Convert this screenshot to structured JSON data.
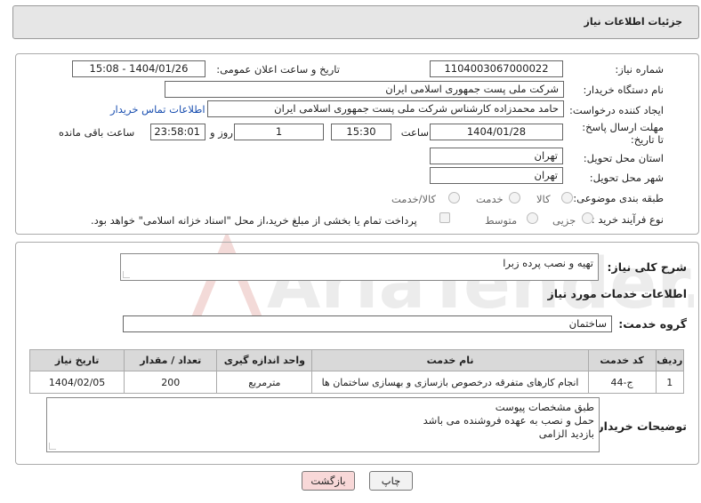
{
  "header": {
    "title": "جزئیات اطلاعات نیاز"
  },
  "form": {
    "need_number_label": "شماره نیاز:",
    "need_number": "1104003067000022",
    "announce_label": "تاریخ و ساعت اعلان عمومی:",
    "announce_value": "1404/01/26 - 15:08",
    "buyer_org_label": "نام دستگاه خریدار:",
    "buyer_org": "شرکت ملی پست جمهوری اسلامی ایران",
    "creator_label": "ایجاد کننده درخواست:",
    "creator": "حامد محمدزاده کارشناس شرکت ملی پست جمهوری اسلامی ایران",
    "contact_link": "اطلاعات تماس خریدار",
    "deadline_label": "مهلت ارسال پاسخ: تا تاریخ:",
    "deadline_date": "1404/01/28",
    "time_label": "ساعت",
    "deadline_time": "15:30",
    "days_value": "1",
    "days_label": "روز و",
    "remaining_time": "23:58:01",
    "remaining_label": "ساعت باقی مانده",
    "province_label": "استان محل تحویل:",
    "province": "تهران",
    "city_label": "شهر محل تحویل:",
    "city": "تهران",
    "category_label": "طبقه بندی موضوعی:",
    "category_options": [
      "کالا",
      "خدمت",
      "کالا/خدمت"
    ],
    "process_label": "نوع فرآیند خرید :",
    "process_options": [
      "جزیی",
      "متوسط"
    ],
    "payment_note": "پرداخت تمام یا بخشی از مبلغ خرید،از محل \"اسناد خزانه اسلامی\" خواهد بود."
  },
  "summary": {
    "label": "شرح کلی نیاز:",
    "value": "تهیه و نصب پرده زبرا"
  },
  "services": {
    "section_title": "اطلاعات خدمات مورد نیاز",
    "group_label": "گروه خدمت:",
    "group_value": "ساختمان",
    "columns": [
      "ردیف",
      "کد خدمت",
      "نام خدمت",
      "واحد اندازه گیری",
      "تعداد / مقدار",
      "تاریخ نیاز"
    ],
    "rows": [
      {
        "row": "1",
        "code": "ج-44",
        "name": "انجام کارهای متفرقه درخصوص بازسازی و بهسازی ساختمان ها",
        "unit": "مترمربع",
        "qty": "200",
        "date": "1404/02/05"
      }
    ]
  },
  "buyer_notes": {
    "label": "توضیحات خریدار:",
    "lines": [
      "طبق مشخصات پیوست",
      "حمل و نصب به عهده فروشنده می باشد",
      "بازدید الزامی"
    ]
  },
  "buttons": {
    "print": "چاپ",
    "back": "بازگشت"
  },
  "watermark": {
    "text": "AriaTender.neT"
  },
  "colors": {
    "link": "#1a4fb0",
    "back_btn": "#f8d8d8",
    "print_btn": "#f2f2f2",
    "watermark": "#c0392b"
  }
}
